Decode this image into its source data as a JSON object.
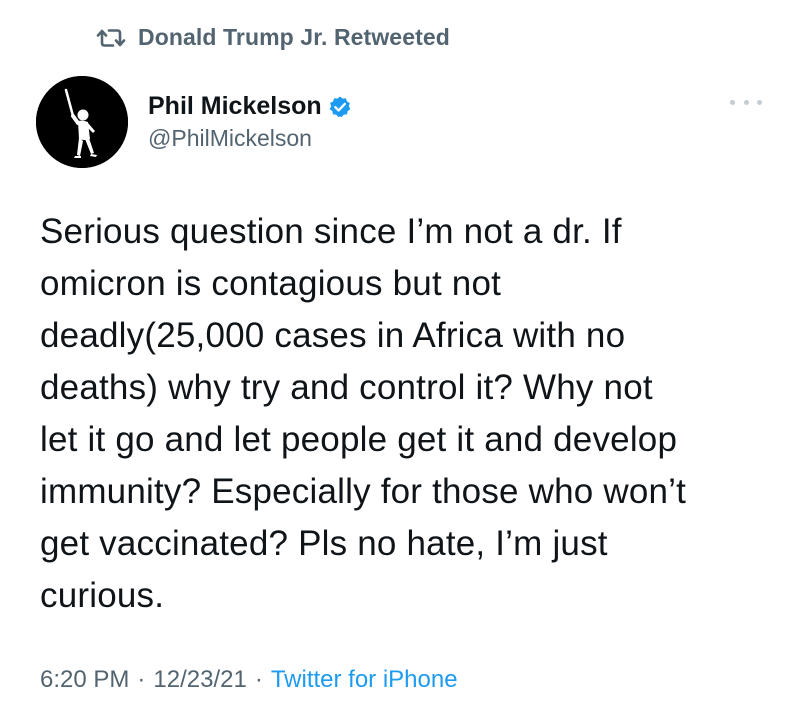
{
  "retweet": {
    "label": "Donald Trump Jr. Retweeted",
    "icon": "retweet-icon"
  },
  "author": {
    "display_name": "Phil Mickelson",
    "handle": "@PhilMickelson",
    "verified": true,
    "avatar_icon": "golfer-silhouette-avatar"
  },
  "tweet": {
    "lines": [
      "Serious question since I’m not a dr. If",
      "omicron is contagious but not",
      "deadly(25,000 cases in Africa with no",
      "deaths) why try and control it? Why not",
      "let it go and let people get it and develop",
      "immunity? Especially for those who won’t",
      "get vaccinated? Pls no hate, I’m just",
      "curious."
    ]
  },
  "meta": {
    "time": "6:20 PM",
    "separator": "·",
    "date": "12/23/21",
    "source": "Twitter for iPhone"
  },
  "colors": {
    "text": "#0f1419",
    "secondary": "#536471",
    "accent": "#1d9bf0",
    "more_dots": "#c4cdd4"
  }
}
